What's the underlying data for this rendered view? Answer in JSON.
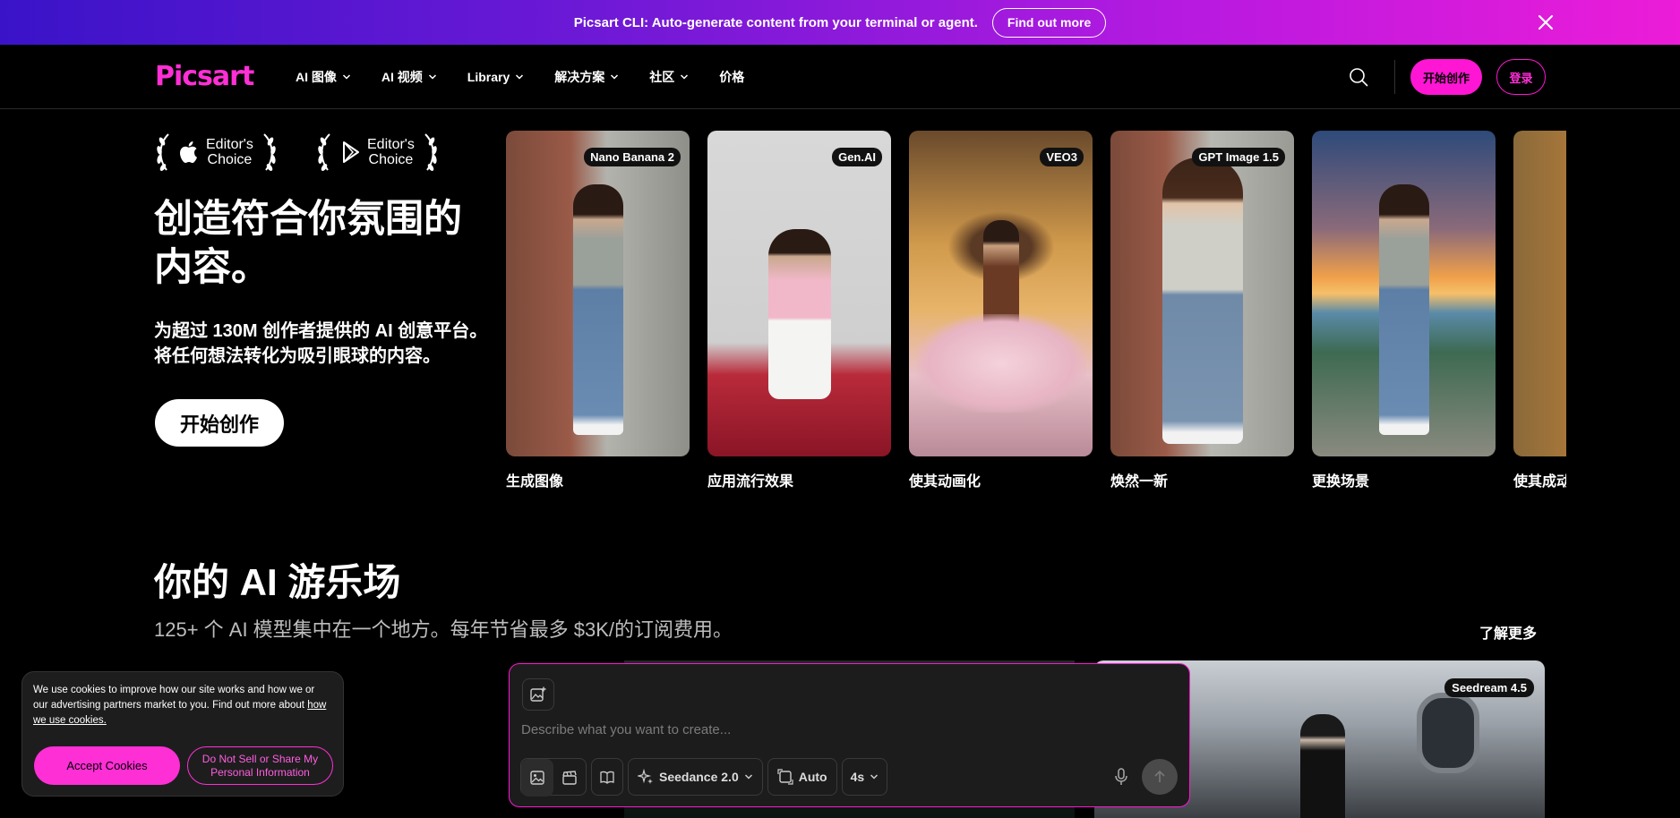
{
  "banner": {
    "text": "Picsart CLI: Auto-generate content from your terminal or agent.",
    "button": "Find out more"
  },
  "nav": {
    "logo": "Picsart",
    "menu": [
      {
        "label": "AI 图像",
        "dropdown": true
      },
      {
        "label": "AI 视频",
        "dropdown": true
      },
      {
        "label": "Library",
        "dropdown": true
      },
      {
        "label": "解决方案",
        "dropdown": true
      },
      {
        "label": "社区",
        "dropdown": true
      },
      {
        "label": "价格",
        "dropdown": false
      }
    ],
    "create_button": "开始创作",
    "login_button": "登录"
  },
  "hero": {
    "awards": [
      {
        "line1": "Editor's",
        "line2": "Choice",
        "icon": "apple-icon"
      },
      {
        "line1": "Editor's",
        "line2": "Choice",
        "icon": "google-play-icon"
      }
    ],
    "title": "创造符合你氛围的内容。",
    "subtitle_line1": "为超过 130M 创作者提供的 AI 创意平台。",
    "subtitle_line2": "将任何想法转化为吸引眼球的内容。",
    "cta": "开始创作"
  },
  "cards": [
    {
      "badge": "Nano Banana 2",
      "label": "生成图像"
    },
    {
      "badge": "Gen.AI",
      "label": "应用流行效果"
    },
    {
      "badge": "VEO3",
      "label": "使其动画化"
    },
    {
      "badge": "GPT Image 1.5",
      "label": "焕然一新"
    },
    {
      "badge": "",
      "label": "更换场景"
    },
    {
      "badge": "",
      "label": "使其成动"
    }
  ],
  "playground": {
    "title": "你的 AI 游乐场",
    "subtitle": "125+ 个 AI 模型集中在一个地方。每年节省最多 $3K/的订阅费用。",
    "learn_more": "了解更多",
    "preview_badge": "Seedream 4.5"
  },
  "prompt": {
    "placeholder": "Describe what you want to create...",
    "model": "Seedance 2.0",
    "aspect": "Auto",
    "duration": "4s"
  },
  "cookie": {
    "text": "We use cookies to improve how our site works and how we or our advertising partners market to you. Find out more about ",
    "link": "how we use cookies.",
    "accept": "Accept Cookies",
    "dns_line1": "Do Not Sell or Share My",
    "dns_line2": "Personal Information"
  },
  "colors": {
    "accent": "#ff16d4",
    "background": "#000000"
  }
}
